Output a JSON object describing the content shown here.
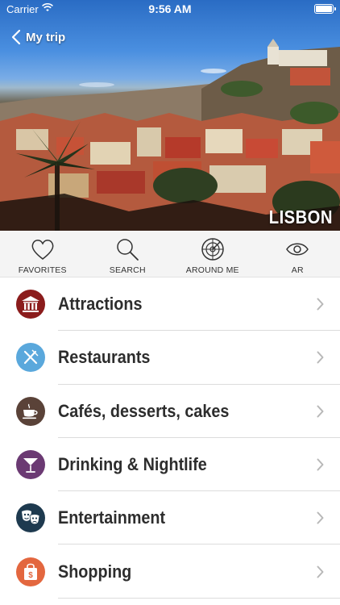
{
  "status_bar": {
    "carrier": "Carrier",
    "time": "9:56 AM"
  },
  "header": {
    "back_label": "My trip",
    "city": "LISBON"
  },
  "toolbar": {
    "items": [
      {
        "label": "FAVORITES",
        "icon": "heart-icon"
      },
      {
        "label": "SEARCH",
        "icon": "search-icon"
      },
      {
        "label": "AROUND ME",
        "icon": "radar-icon"
      },
      {
        "label": "AR",
        "icon": "eye-icon"
      }
    ]
  },
  "categories": [
    {
      "label": "Attractions",
      "icon": "museum-icon",
      "color": "#8b1c1c"
    },
    {
      "label": "Restaurants",
      "icon": "fork-knife-icon",
      "color": "#5aa8dc"
    },
    {
      "label": "Cafés, desserts, cakes",
      "icon": "coffee-cup-icon",
      "color": "#5a4238"
    },
    {
      "label": "Drinking & Nightlife",
      "icon": "cocktail-icon",
      "color": "#6b3a73"
    },
    {
      "label": "Entertainment",
      "icon": "theater-masks-icon",
      "color": "#1e3a4f"
    },
    {
      "label": "Shopping",
      "icon": "shopping-bag-icon",
      "color": "#e3673f"
    }
  ]
}
